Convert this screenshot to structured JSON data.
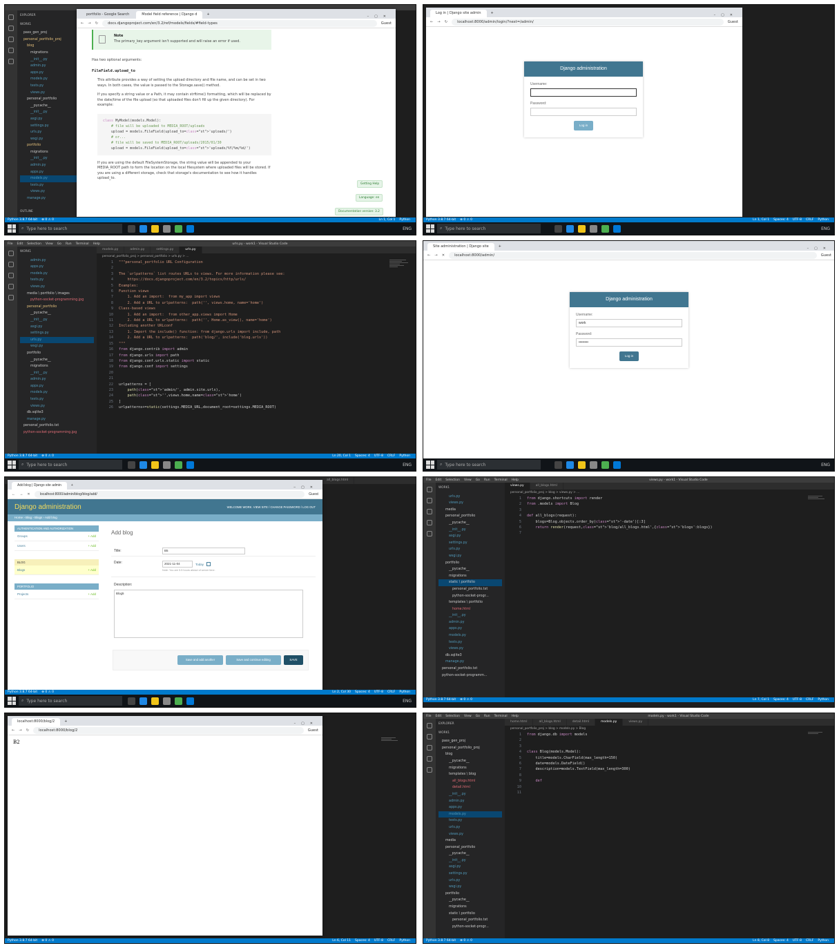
{
  "taskbar": {
    "search_placeholder": "Type here to search",
    "lang": "ENG"
  },
  "vscode_status": {
    "python": "Python 3.8.7 64-bit",
    "errors": "⊗ 0 ⚠ 0",
    "encoding": "UTF-8",
    "eol": "CRLF",
    "lang": "Python",
    "spaces": "Spaces: 4"
  },
  "tile1": {
    "tabs": [
      "portfolio - Google Search",
      "Model field reference | Django d"
    ],
    "url": "docs.djangoproject.com/en/3.2/ref/models/fields/#field-types",
    "note_title": "Note",
    "note_text": "The primary_key argument isn't supported and will raise an error if used.",
    "p1": "Has two optional arguments:",
    "h1": "FileField.upload_to",
    "p2": "This attribute provides a way of setting the upload directory and file name, and can be set in two ways. In both cases, the value is passed to the Storage.save() method.",
    "p3": "If you specify a string value or a Path, it may contain strftime() formatting, which will be replaced by the date/time of the file upload (so that uploaded files don't fill up the given directory). For example:",
    "code": [
      "class MyModel(models.Model):",
      "    # file will be uploaded to MEDIA_ROOT/uploads",
      "    upload = models.FileField(upload_to='uploads/')",
      "    # or...",
      "    # file will be saved to MEDIA_ROOT/uploads/2015/01/30",
      "    upload = models.FileField(upload_to='uploads/%Y/%m/%d/')"
    ],
    "p4": "If you are using the default FileSystemStorage, the string value will be appended to your MEDIA_ROOT path to form the location on the local filesystem where uploaded files will be stored. If you are using a different storage, check that storage's documentation to see how it handles upload_to.",
    "getting_help": "Getting Help",
    "language": "Language: en",
    "doc_version": "Documentation version: 3.2",
    "explorer": [
      "EXPLORER",
      "WORK1",
      "pass_gen_proj",
      "personal_portfolio_proj",
      "blog",
      "migrations",
      "__init__.py",
      "admin.py",
      "apps.py",
      "models.py",
      "tests.py",
      "views.py",
      "personal_portfolio",
      "__pycache__",
      "__init__.py",
      "asgi.py",
      "settings.py",
      "urls.py",
      "wsgi.py",
      "portfolio",
      "migrations",
      "__init__.py",
      "admin.py",
      "apps.py",
      "models.py",
      "tests.py",
      "views.py",
      "manage.py"
    ],
    "outline": "OUTLINE",
    "status_pos": "Ln 1, Col 1"
  },
  "tile2": {
    "tab": "Log in | Django site admin",
    "url": "localhost:8000/admin/login/?next=/admin/",
    "header": "Django administration",
    "username_label": "Username:",
    "password_label": "Password:",
    "login_button": "Log in",
    "status_pos": "Ln 1, Col 1"
  },
  "tile3": {
    "title": "urls.py - work1 - Visual Studio Code",
    "menu": [
      "File",
      "Edit",
      "Selection",
      "View",
      "Go",
      "Run",
      "Terminal",
      "Help"
    ],
    "tabs": [
      "models.py",
      "admin.py",
      "settings.py",
      "urls.py"
    ],
    "crumbs": "personal_portfolio_proj > personal_portfolio > urls.py > ...",
    "explorer": [
      "WORK1",
      "admin.py",
      "apps.py",
      "models.py",
      "tests.py",
      "views.py",
      "media \\ portfolio \\ images",
      "python-socket-programming.jpg",
      "personal_portfolio",
      "__pycache__",
      "__init__.py",
      "asgi.py",
      "settings.py",
      "urls.py",
      "wsgi.py",
      "portfolio",
      "__pycache__",
      "migrations",
      "__init__.py",
      "admin.py",
      "apps.py",
      "models.py",
      "tests.py",
      "views.py",
      "db.sqlite3",
      "manage.py",
      "personal_portfolio.txt",
      "python-socket-programming.jpg"
    ],
    "code": [
      "\"\"\"personal_portfolio URL Configuration",
      "",
      "The `urlpatterns` list routes URLs to views. For more information please see:",
      "    https://docs.djangoproject.com/en/3.2/topics/http/urls/",
      "Examples:",
      "Function views",
      "    1. Add an import:  from my_app import views",
      "    2. Add a URL to urlpatterns:  path('', views.home, name='home')",
      "Class-based views",
      "    1. Add an import:  from other_app.views import Home",
      "    2. Add a URL to urlpatterns:  path('', Home.as_view(), name='home')",
      "Including another URLconf",
      "    1. Import the include() function: from django.urls import include, path",
      "    2. Add a URL to urlpatterns:  path('blog/', include('blog.urls'))",
      "\"\"\"",
      "from django.contrib import admin",
      "from django.urls import path",
      "from django.conf.urls.static import static",
      "from django.conf import settings",
      "",
      "",
      "urlpatterns = [",
      "    path('admin/', admin.site.urls),",
      "    path('',views.home,name='home')",
      "]",
      "urlpatterns+=static(settings.MEDIA_URL,document_root=settings.MEDIA_ROOT)"
    ],
    "status_pos": "Ln 20, Col 1"
  },
  "tile4": {
    "tab": "Site administration | Django site",
    "url": "localhost:8000/admin/",
    "header": "Django administration",
    "username_label": "Username:",
    "username_value": "work",
    "password_label": "Password:",
    "password_value": "••••••••",
    "login_button": "Log in"
  },
  "tile5": {
    "tab": "Add blog | Django site admin",
    "url": "localhost:8000/admin/blog/blog/add/",
    "brand": "Django administration",
    "welcome": "WELCOME WORK. VIEW SITE / CHANGE PASSWORD / LOG OUT",
    "breadcrumb": "Home › Blog › Blogs › Add blog",
    "sections": [
      {
        "caption": "AUTHENTICATION AND AUTHORIZATION",
        "rows": [
          "Groups",
          "Users"
        ]
      },
      {
        "caption": "BLOG",
        "rows": [
          "Blogs"
        ]
      },
      {
        "caption": "PORTFOLIO",
        "rows": [
          "Projects"
        ]
      }
    ],
    "add_label": "+ Add",
    "form_title": "Add blog",
    "title_label": "Title:",
    "title_value": "B5",
    "date_label": "Date:",
    "date_value": "2021-11-04",
    "today": "Today",
    "date_note": "Note: You are 5.5 hours ahead of server time.",
    "desc_label": "Description:",
    "desc_value": "Blog5",
    "btn_save_add": "Save and add another",
    "btn_save_continue": "Save and continue editing",
    "btn_save": "SAVE",
    "side_tab": "all_blogs.html",
    "status_pos": "Ln 2, Col 30"
  },
  "tile6": {
    "title": "views.py - work1 - Visual Studio Code",
    "tabs": [
      "views.py",
      "all_blogs.html"
    ],
    "crumbs": "personal_portfolio_proj > blog > views.py > ...",
    "explorer": [
      "WORK1",
      "urls.py",
      "views.py",
      "media",
      "personal_portfolio",
      "__pycache__",
      "__init__.py",
      "asgi.py",
      "settings.py",
      "urls.py",
      "wsgi.py",
      "portfolio",
      "__pycache__",
      "migrations",
      "static \\ portfolio",
      "personal_portfolio.txt",
      "python-socket-progr...",
      "templates \\ portfolio",
      "home.html",
      "__init__.py",
      "admin.py",
      "apps.py",
      "models.py",
      "tests.py",
      "views.py",
      "db.sqlite3",
      "manage.py",
      "personal_portfolio.txt",
      "python-socket-programm..."
    ],
    "code": [
      "from django.shortcuts import render",
      "from .models import Blog",
      "",
      "def all_blogs(request):",
      "    blogs=Blog.objects.order_by('-date')[:3]",
      "    return render(request,'blog/all_blogs.html',{'blogs':blogs})",
      ""
    ],
    "status_pos": "Ln 7, Col 1"
  },
  "tile7": {
    "tab": "localhost:8000/blog/2",
    "url": "localhost:8000/blog/2",
    "page_text": "B2",
    "status_pos": "Ln 6, Col 11"
  },
  "tile8": {
    "title": "models.py - work1 - Visual Studio Code",
    "tabs": [
      "home.html",
      "all_blogs.html",
      "detail.html",
      "models.py",
      "views.py"
    ],
    "crumbs": "personal_portfolio_proj > blog > models.py > Blog",
    "explorer": [
      "EXPLORER",
      "WORK1",
      "pass_gen_proj",
      "personal_portfolio_proj",
      "blog",
      "__pycache__",
      "migrations",
      "templates \\ blog",
      "all_blogs.html",
      "detail.html",
      "__init__.py",
      "admin.py",
      "apps.py",
      "models.py",
      "tests.py",
      "urls.py",
      "views.py",
      "media",
      "personal_portfolio",
      "__pycache__",
      "__init__.py",
      "asgi.py",
      "settings.py",
      "urls.py",
      "wsgi.py",
      "portfolio",
      "__pycache__",
      "migrations",
      "static \\ portfolio",
      "personal_portfolio.txt",
      "python-socket-progr..."
    ],
    "code": [
      "from django.db import models",
      "",
      "",
      "class Blog(models.Model):",
      "    title=models.CharField(max_length=150)",
      "    date=models.DateField()",
      "    description=models.TextField(max_length=300)",
      "",
      "    def",
      "",
      ""
    ],
    "status_pos": "Ln 8, Col 8"
  }
}
